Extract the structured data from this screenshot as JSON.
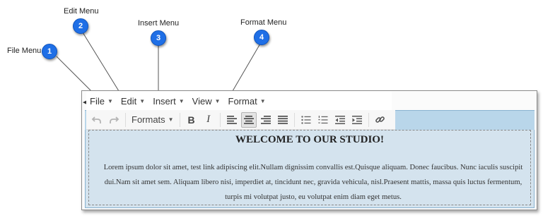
{
  "callouts": [
    {
      "number": "1",
      "label": "File Menu"
    },
    {
      "number": "2",
      "label": "Edit Menu"
    },
    {
      "number": "3",
      "label": "Insert Menu"
    },
    {
      "number": "4",
      "label": "Format Menu"
    }
  ],
  "colors": {
    "badge": "#1f6fe6",
    "leader_line": "#555555",
    "toolbar_strip": "#b9d6ea",
    "content_bg": "#d4e3ee"
  },
  "menubar": {
    "items": [
      {
        "label": "File"
      },
      {
        "label": "Edit"
      },
      {
        "label": "Insert"
      },
      {
        "label": "View"
      },
      {
        "label": "Format"
      }
    ]
  },
  "toolbar": {
    "undo_icon": "undo-icon",
    "redo_icon": "redo-icon",
    "formats_label": "Formats",
    "bold_label": "B",
    "italic_label": "I",
    "align_icons": [
      "align-left-icon",
      "align-center-icon",
      "align-right-icon",
      "align-justify-icon"
    ],
    "active_align": "align-center",
    "list_icons": [
      "bullet-list-icon",
      "numbered-list-icon",
      "outdent-icon",
      "indent-icon"
    ],
    "link_icon": "link-icon"
  },
  "content": {
    "heading": "WELCOME TO OUR STUDIO!",
    "paragraph": "Lorem ipsum dolor sit amet, test link adipiscing elit.Nullam dignissim convallis est.Quisque aliquam. Donec faucibus. Nunc iaculis suscipit dui.Nam sit amet sem. Aliquam libero nisi, imperdiet at, tincidunt nec, gravida vehicula, nisl.Praesent mattis, massa quis luctus fermentum, turpis mi volutpat justo, eu volutpat enim diam eget metus."
  }
}
